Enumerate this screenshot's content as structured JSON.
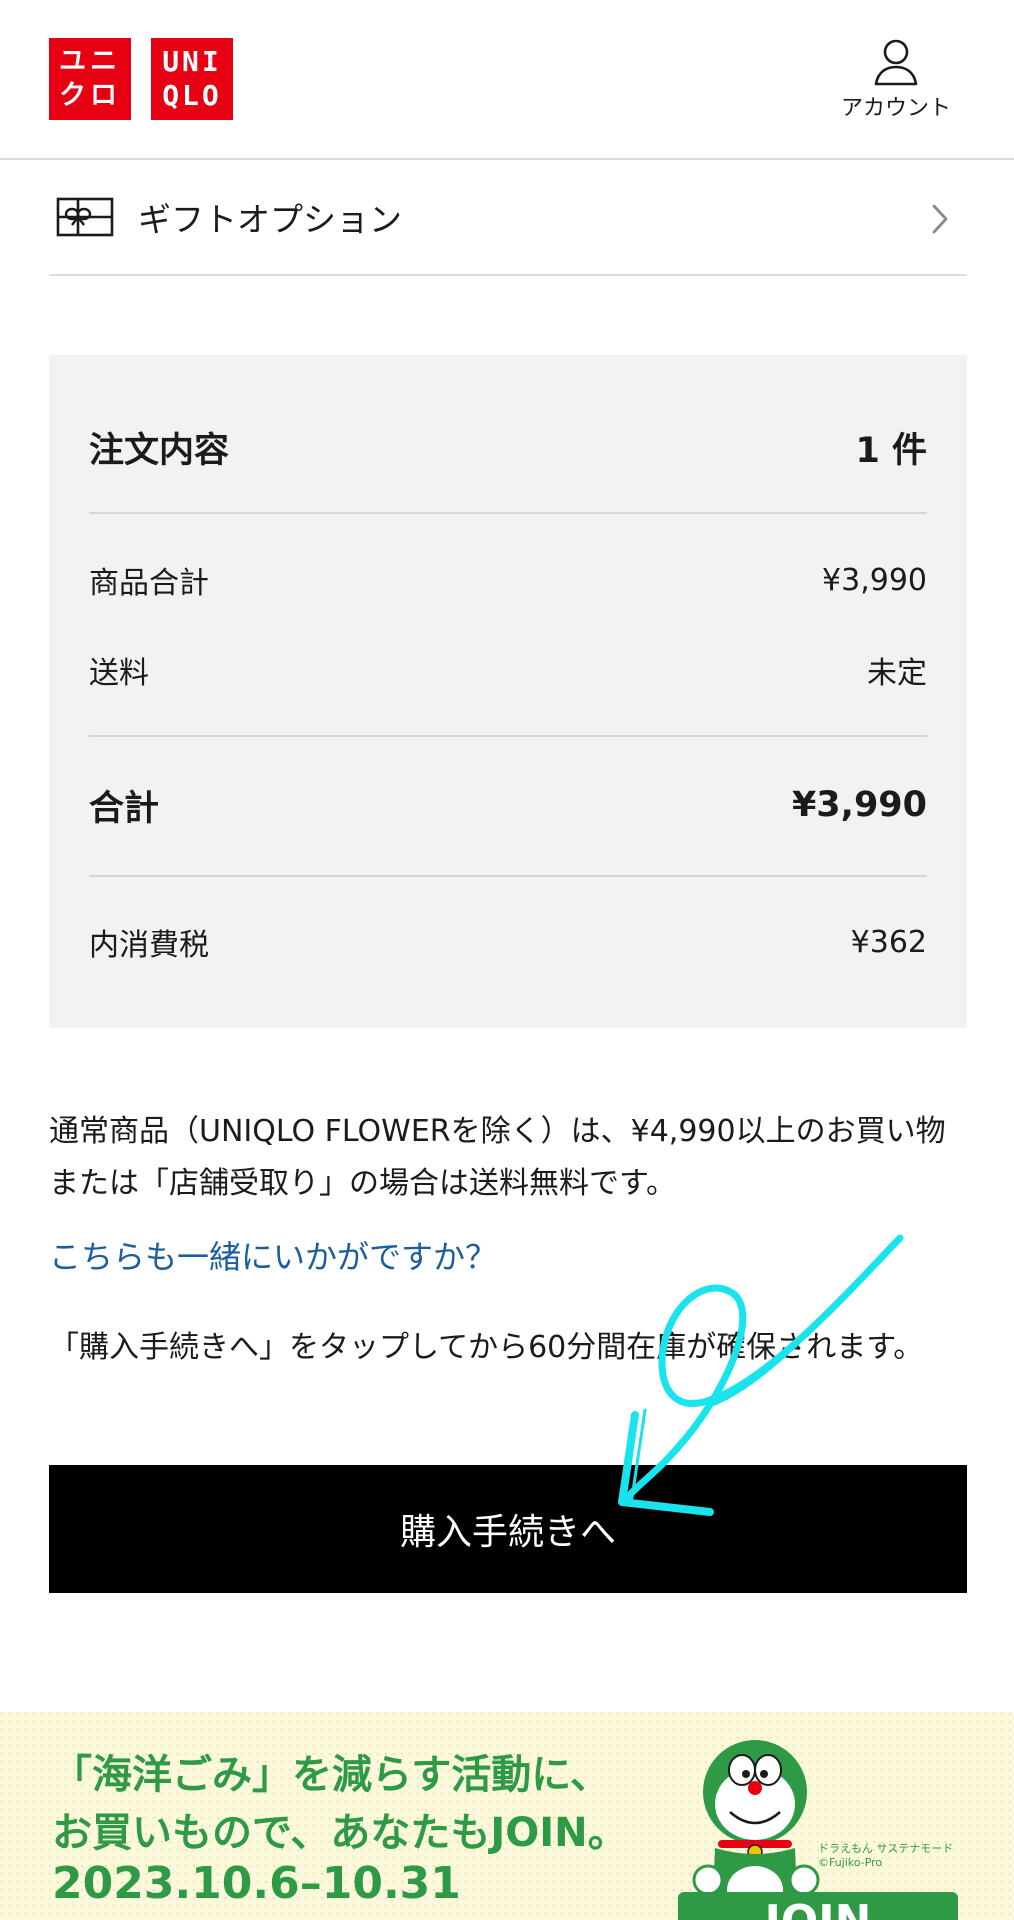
{
  "header": {
    "logo_jp": [
      "ユニ",
      "クロ"
    ],
    "logo_en": [
      "UNI",
      "QLO"
    ],
    "account_label": "アカウント"
  },
  "gift": {
    "label": "ギフトオプション"
  },
  "summary": {
    "title": "注文内容",
    "count": "1 件",
    "subtotal_label": "商品合計",
    "subtotal_value": "¥3,990",
    "shipping_label": "送料",
    "shipping_value": "未定",
    "total_label": "合計",
    "total_value": "¥3,990",
    "tax_label": "内消費税",
    "tax_value": "¥362"
  },
  "notes": {
    "shipping_note": "通常商品（UNIQLO FLOWERを除く）は、¥4,990以上のお買い物または「店舗受取り」の場合は送料無料です。",
    "recommend_link": "こちらも一緒にいかがですか？",
    "reserve_note": "「購入手続きへ」をタップしてから60分間在庫が確保されます。"
  },
  "checkout": {
    "label": "購入手続きへ"
  },
  "banner": {
    "line1": "「海洋ごみ」を減らす活動に、",
    "line2": "お買いもので、あなたもJOIN。",
    "line3": "2023.10.6–10.31",
    "credit1": "ドラえもん サステナモード",
    "credit2": "©Fujiko-Pro",
    "badge": "JOIN"
  },
  "colors": {
    "brand_red": "#e60012",
    "link_blue": "#1a5f9c",
    "button_black": "#000000",
    "summary_bg": "#f2f2f2",
    "banner_green": "#2f9a46",
    "annotation_cyan": "#19e3ec"
  }
}
